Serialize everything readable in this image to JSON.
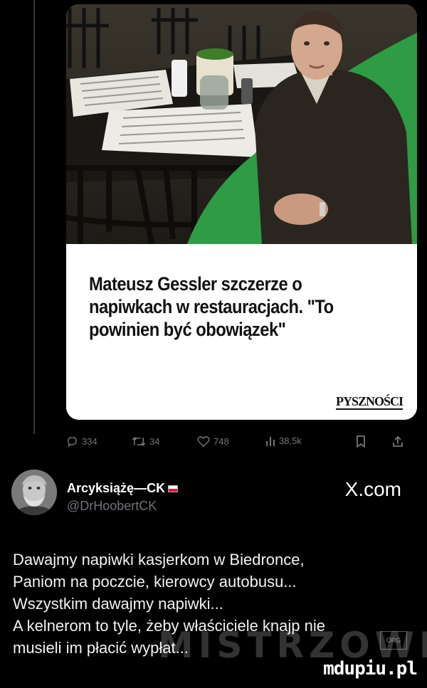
{
  "card": {
    "headline": "Mateusz Gessler szczerze o napiwkach w restauracjach. \"To powinien być obowiązek\"",
    "publisher": "PYSZNOŚCI"
  },
  "actions": {
    "replies": "334",
    "retweets": "34",
    "likes": "748",
    "views": "38,5k"
  },
  "author": {
    "name": "Arcyksiążę—CK",
    "handle": "@DrHoobertCK"
  },
  "platform": "X.com",
  "tweet": {
    "lines": [
      "Dawajmy napiwki kasjerkom w Biedronce,",
      "Paniom na poczcie, kierowcy autobusu...",
      "Wszystkim dawajmy napiwki...",
      "A kelnerom to tyle, żeby właściciele knajp nie",
      "musieli im płacić wypłat..."
    ]
  },
  "watermark": {
    "text": "MISTRZOWIE",
    "badge": "ORG"
  },
  "site": "mdupiu.pl",
  "colors": {
    "background": "#000000",
    "muted": "#71767b",
    "text": "#e7e9ea",
    "photo_green": "#2e9b45"
  }
}
